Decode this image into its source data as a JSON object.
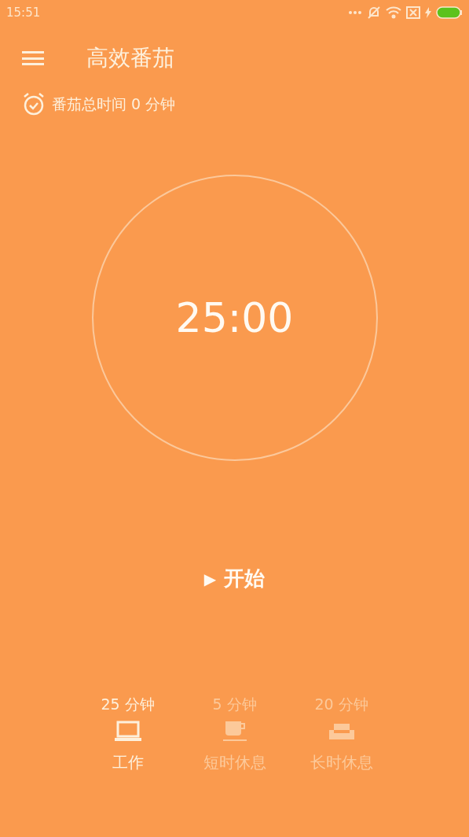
{
  "status_bar": {
    "time": "15:51"
  },
  "header": {
    "title": "高效番茄"
  },
  "summary": {
    "text": "番茄总时间 0 分钟"
  },
  "timer": {
    "time": "25:00"
  },
  "start_button": {
    "icon": "▶",
    "label": "开始"
  },
  "modes": [
    {
      "kind": "work",
      "duration": "25 分钟",
      "label": "工作",
      "selected": true
    },
    {
      "kind": "short",
      "duration": "5 分钟",
      "label": "短时休息",
      "selected": false
    },
    {
      "kind": "long",
      "duration": "20 分钟",
      "label": "长时休息",
      "selected": false
    }
  ]
}
